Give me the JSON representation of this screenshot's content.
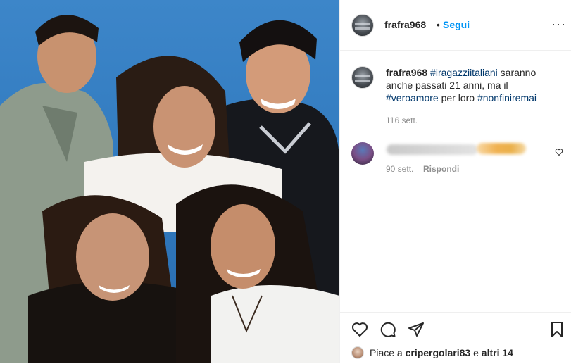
{
  "post": {
    "author": "frafra968",
    "separator": "•",
    "follow_label": "Segui",
    "more_label": "···",
    "caption": {
      "username": "frafra968",
      "tag1": "#iragazziitaliani",
      "text1": " saranno anche passati 21 anni, ma il ",
      "tag2": "#veroamore",
      "text2": " per loro ",
      "tag3": "#nonfiniremai",
      "time": "116 sett."
    },
    "comment": {
      "time": "90 sett.",
      "reply_label": "Rispondi"
    },
    "likes": {
      "prefix": "Piace a ",
      "user": "cripergolari83",
      "middle": " e ",
      "others": "altri 14"
    },
    "icons": [
      "heart-icon",
      "comment-icon",
      "share-icon",
      "bookmark-icon",
      "more-icon"
    ],
    "colors": {
      "accent": "#0095f6",
      "hashtag": "#00376b",
      "muted": "#8e8e8e",
      "photo_background": "#3d86c9"
    }
  }
}
